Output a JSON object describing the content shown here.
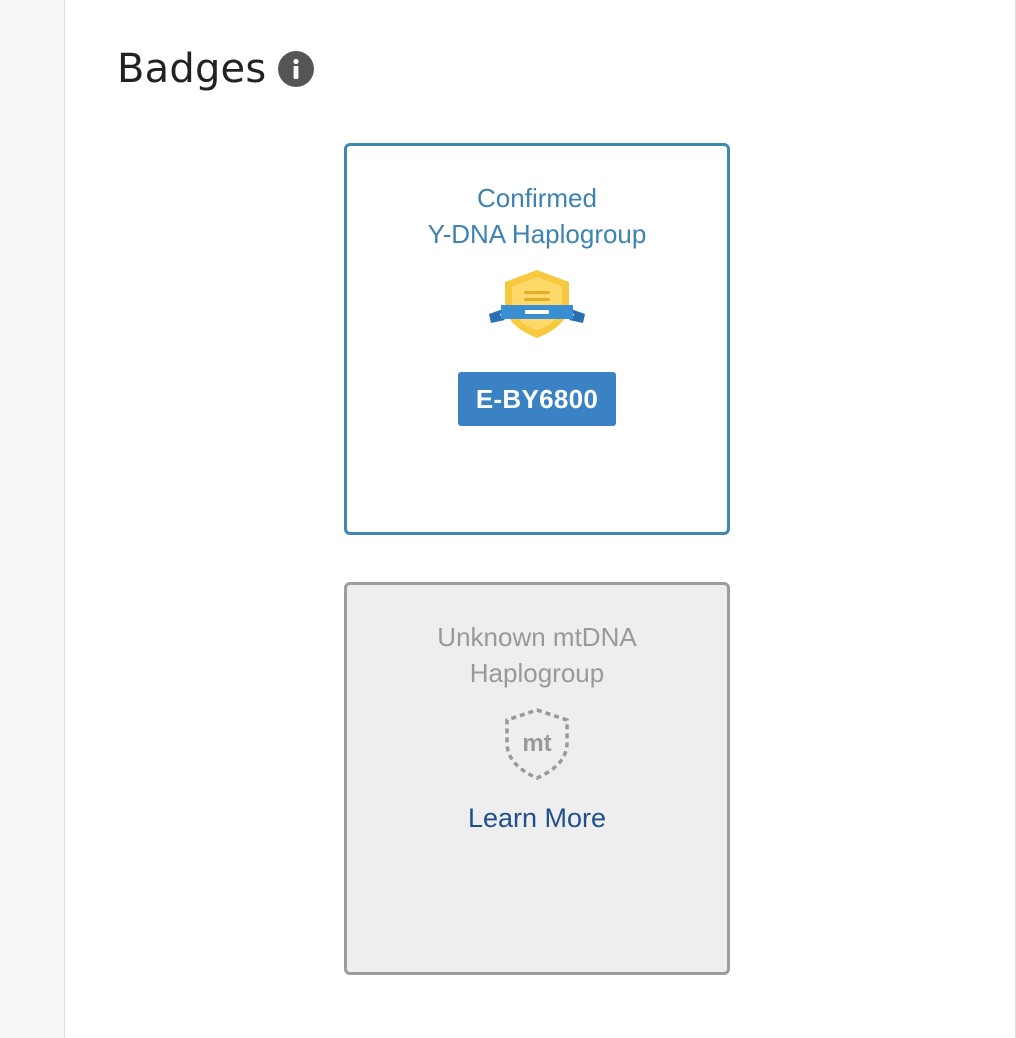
{
  "section": {
    "title": "Badges",
    "info_icon": "info-icon"
  },
  "badges": [
    {
      "state": "confirmed",
      "title_lines": [
        "Confirmed",
        "Y-DNA Haplogroup"
      ],
      "icon": "shield-ribbon-icon",
      "haplogroup": "E-BY6800",
      "accent_color": "#3f86b3"
    },
    {
      "state": "unknown",
      "title_lines": [
        "Unknown mtDNA",
        "Haplogroup"
      ],
      "icon": "dashed-shield-icon",
      "icon_text": "mt",
      "link_label": "Learn More",
      "accent_color": "#9a9e9f"
    }
  ]
}
